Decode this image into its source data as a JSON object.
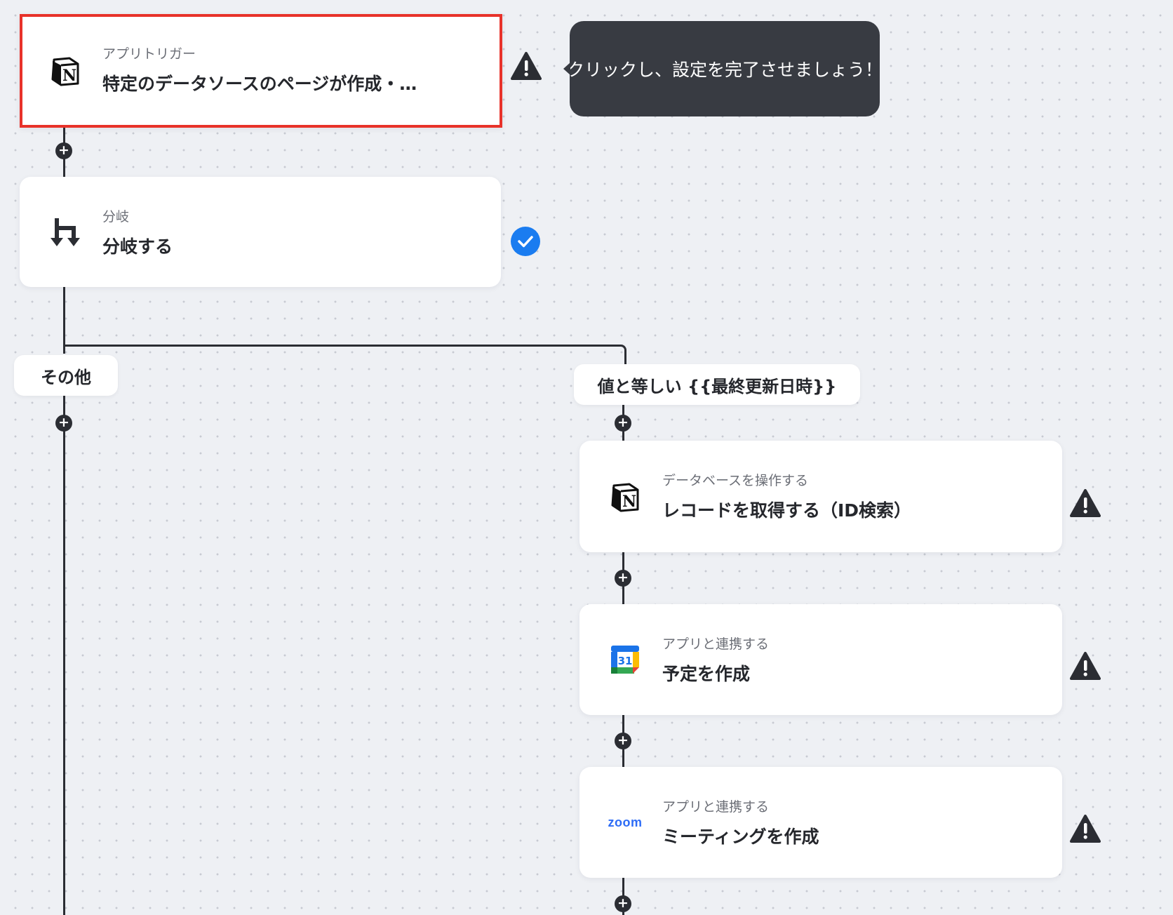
{
  "trigger": {
    "subtitle": "アプリトリガー",
    "title": "特定のデータソースのページが作成・…",
    "app_icon": "notion-icon",
    "status": "warning"
  },
  "tooltip": {
    "text": "クリックし、設定を完了させましょう！"
  },
  "branch": {
    "subtitle": "分岐",
    "title": "分岐する",
    "app_icon": "branch-icon",
    "status": "complete"
  },
  "branch_labels": {
    "other": "その他",
    "condition": "値と等しい {{最終更新日時}}"
  },
  "steps": [
    {
      "subtitle": "データベースを操作する",
      "title": "レコードを取得する（ID検索）",
      "app_icon": "notion-icon",
      "status": "warning"
    },
    {
      "subtitle": "アプリと連携する",
      "title": "予定を作成",
      "app_icon": "google-calendar-icon",
      "calendar_day": "31",
      "status": "warning"
    },
    {
      "subtitle": "アプリと連携する",
      "title": "ミーティングを作成",
      "app_icon": "zoom-icon",
      "zoom_text": "zoom",
      "status": "warning"
    }
  ],
  "colors": {
    "warning": "#2b2d33",
    "complete": "#1a7cf0",
    "selected_border": "#e8322a",
    "tooltip_bg": "#383b42",
    "zoom_blue": "#2d6cf6"
  }
}
